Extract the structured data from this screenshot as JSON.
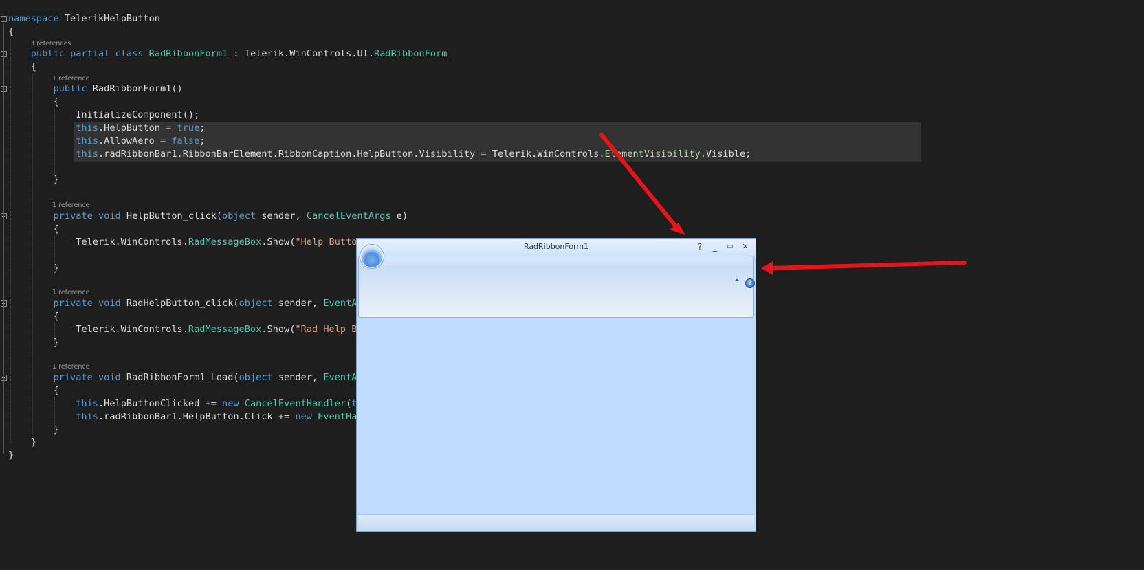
{
  "editor": {
    "lines": [
      {
        "tokens": [
          {
            "c": "kw",
            "t": "namespace"
          },
          {
            "c": "plain",
            "t": " TelerikHelpButton"
          }
        ]
      },
      {
        "tokens": [
          {
            "c": "plain",
            "t": "{"
          }
        ]
      },
      {
        "tokens": [
          {
            "c": "plain",
            "t": "    "
          },
          {
            "c": "kw",
            "t": "public"
          },
          {
            "c": "plain",
            "t": " "
          },
          {
            "c": "kw",
            "t": "partial"
          },
          {
            "c": "plain",
            "t": " "
          },
          {
            "c": "kw",
            "t": "class"
          },
          {
            "c": "plain",
            "t": " "
          },
          {
            "c": "type",
            "t": "RadRibbonForm1"
          },
          {
            "c": "plain",
            "t": " : Telerik.WinControls.UI."
          },
          {
            "c": "type",
            "t": "RadRibbonForm"
          }
        ]
      },
      {
        "tokens": [
          {
            "c": "plain",
            "t": "    {"
          }
        ]
      },
      {
        "tokens": [
          {
            "c": "plain",
            "t": "        "
          },
          {
            "c": "kw",
            "t": "public"
          },
          {
            "c": "plain",
            "t": " RadRibbonForm1()"
          }
        ]
      },
      {
        "tokens": [
          {
            "c": "plain",
            "t": "        {"
          }
        ]
      },
      {
        "tokens": [
          {
            "c": "plain",
            "t": "            InitializeComponent();"
          }
        ]
      },
      {
        "tokens": [
          {
            "c": "plain",
            "t": "            "
          },
          {
            "c": "kw",
            "t": "this"
          },
          {
            "c": "plain",
            "t": ".HelpButton = "
          },
          {
            "c": "kw",
            "t": "true"
          },
          {
            "c": "plain",
            "t": ";"
          }
        ]
      },
      {
        "tokens": [
          {
            "c": "plain",
            "t": "            "
          },
          {
            "c": "kw",
            "t": "this"
          },
          {
            "c": "plain",
            "t": ".AllowAero = "
          },
          {
            "c": "kw",
            "t": "false"
          },
          {
            "c": "plain",
            "t": ";"
          }
        ]
      },
      {
        "tokens": [
          {
            "c": "plain",
            "t": "            "
          },
          {
            "c": "kw",
            "t": "this"
          },
          {
            "c": "plain",
            "t": ".radRibbonBar1.RibbonBarElement.RibbonCaption.HelpButton.Visibility = Telerik.WinControls."
          },
          {
            "c": "enum",
            "t": "ElementVisibility"
          },
          {
            "c": "plain",
            "t": ".Visible;"
          }
        ]
      },
      {
        "tokens": []
      },
      {
        "tokens": [
          {
            "c": "plain",
            "t": "        }"
          }
        ]
      },
      {
        "tokens": [
          {
            "c": "plain",
            "t": "        "
          },
          {
            "c": "kw",
            "t": "private"
          },
          {
            "c": "plain",
            "t": " "
          },
          {
            "c": "kw",
            "t": "void"
          },
          {
            "c": "plain",
            "t": " HelpButton_click("
          },
          {
            "c": "kw",
            "t": "object"
          },
          {
            "c": "plain",
            "t": " sender, "
          },
          {
            "c": "type",
            "t": "CancelEventArgs"
          },
          {
            "c": "plain",
            "t": " e)"
          }
        ]
      },
      {
        "tokens": [
          {
            "c": "plain",
            "t": "        {"
          }
        ]
      },
      {
        "tokens": [
          {
            "c": "plain",
            "t": "            Telerik.WinControls."
          },
          {
            "c": "type",
            "t": "RadMessageBox"
          },
          {
            "c": "plain",
            "t": ".Show("
          },
          {
            "c": "str",
            "t": "\"Help Button"
          }
        ]
      },
      {
        "tokens": []
      },
      {
        "tokens": [
          {
            "c": "plain",
            "t": "        }"
          }
        ]
      },
      {
        "tokens": [
          {
            "c": "plain",
            "t": "        "
          },
          {
            "c": "kw",
            "t": "private"
          },
          {
            "c": "plain",
            "t": " "
          },
          {
            "c": "kw",
            "t": "void"
          },
          {
            "c": "plain",
            "t": " RadHelpButton_click("
          },
          {
            "c": "kw",
            "t": "object"
          },
          {
            "c": "plain",
            "t": " sender, "
          },
          {
            "c": "type",
            "t": "EventAr"
          }
        ]
      },
      {
        "tokens": [
          {
            "c": "plain",
            "t": "        {"
          }
        ]
      },
      {
        "tokens": [
          {
            "c": "plain",
            "t": "            Telerik.WinControls."
          },
          {
            "c": "type",
            "t": "RadMessageBox"
          },
          {
            "c": "plain",
            "t": ".Show("
          },
          {
            "c": "str",
            "t": "\"Rad Help Bu"
          }
        ]
      },
      {
        "tokens": [
          {
            "c": "plain",
            "t": "        }"
          }
        ]
      },
      {
        "tokens": [
          {
            "c": "plain",
            "t": "        "
          },
          {
            "c": "kw",
            "t": "private"
          },
          {
            "c": "plain",
            "t": " "
          },
          {
            "c": "kw",
            "t": "void"
          },
          {
            "c": "plain",
            "t": " RadRibbonForm1_Load("
          },
          {
            "c": "kw",
            "t": "object"
          },
          {
            "c": "plain",
            "t": " sender, "
          },
          {
            "c": "type",
            "t": "EventAr"
          }
        ]
      },
      {
        "tokens": [
          {
            "c": "plain",
            "t": "        {"
          }
        ]
      },
      {
        "tokens": [
          {
            "c": "plain",
            "t": "            "
          },
          {
            "c": "kw",
            "t": "this"
          },
          {
            "c": "plain",
            "t": ".HelpButtonClicked += "
          },
          {
            "c": "kw",
            "t": "new"
          },
          {
            "c": "plain",
            "t": " "
          },
          {
            "c": "type",
            "t": "CancelEventHandler"
          },
          {
            "c": "plain",
            "t": "("
          },
          {
            "c": "kw",
            "t": "th"
          }
        ]
      },
      {
        "tokens": [
          {
            "c": "plain",
            "t": "            "
          },
          {
            "c": "kw",
            "t": "this"
          },
          {
            "c": "plain",
            "t": ".radRibbonBar1.HelpButton.Click += "
          },
          {
            "c": "kw",
            "t": "new"
          },
          {
            "c": "plain",
            "t": " "
          },
          {
            "c": "type",
            "t": "EventHan"
          }
        ]
      },
      {
        "tokens": [
          {
            "c": "plain",
            "t": "        }"
          }
        ]
      },
      {
        "tokens": [
          {
            "c": "plain",
            "t": "    }"
          }
        ]
      },
      {
        "tokens": [
          {
            "c": "plain",
            "t": "}"
          }
        ]
      }
    ],
    "codelens": [
      {
        "text": "3 references",
        "line": 2
      },
      {
        "text": "1 reference",
        "line": 4
      },
      {
        "text": "1 reference",
        "line": 12
      },
      {
        "text": "1 reference",
        "line": 17
      },
      {
        "text": "1 reference",
        "line": 21
      }
    ]
  },
  "window": {
    "title": "RadRibbonForm1",
    "caption_help": "?",
    "caption_minimize": "_",
    "caption_maximize": "▭",
    "caption_close": "✕",
    "ribbon_collapse": "^",
    "ribbon_help": "?"
  },
  "colors": {
    "editor_bg": "#1e1e1e",
    "keyword": "#569cd6",
    "type": "#4ec9b0",
    "string": "#d69d85",
    "arrow": "#e8141b"
  }
}
